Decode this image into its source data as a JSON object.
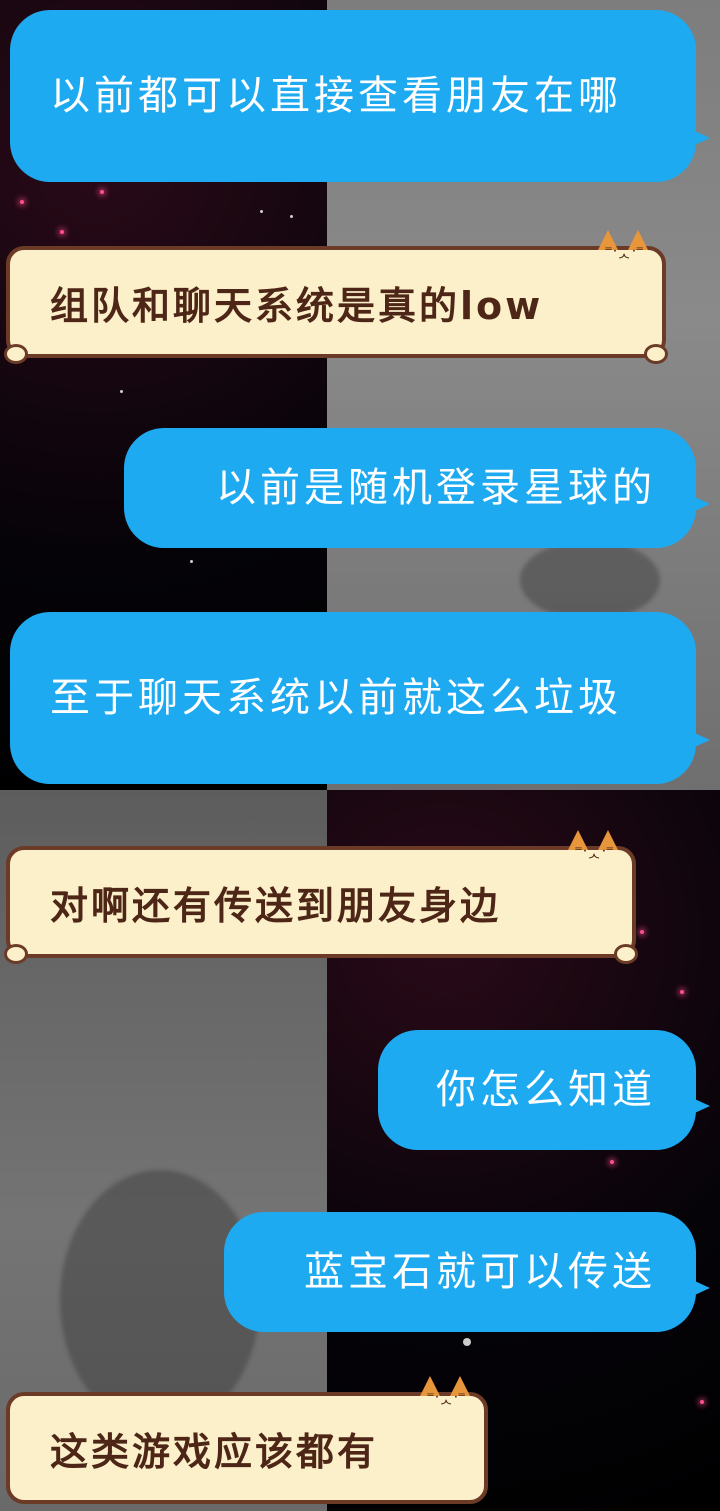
{
  "colors": {
    "outgoing_bubble": "#1eaaf1",
    "incoming_bubble": "#fbf0c9",
    "incoming_border": "#6b3b28",
    "incoming_text": "#4d2617",
    "outgoing_text": "#ffffff"
  },
  "messages": [
    {
      "side": "left-blue",
      "text": "以前都可以直接查看朋友在哪"
    },
    {
      "side": "left-cat",
      "text": "组队和聊天系统是真的low"
    },
    {
      "side": "right-blue",
      "text": "以前是随机登录星球的"
    },
    {
      "side": "left-blue",
      "text": "至于聊天系统以前就这么垃圾"
    },
    {
      "side": "left-cat",
      "text": "对啊还有传送到朋友身边"
    },
    {
      "side": "right-blue",
      "text": "你怎么知道"
    },
    {
      "side": "right-blue",
      "text": "蓝宝石就可以传送"
    },
    {
      "side": "left-cat",
      "text": "这类游戏应该都有"
    }
  ]
}
